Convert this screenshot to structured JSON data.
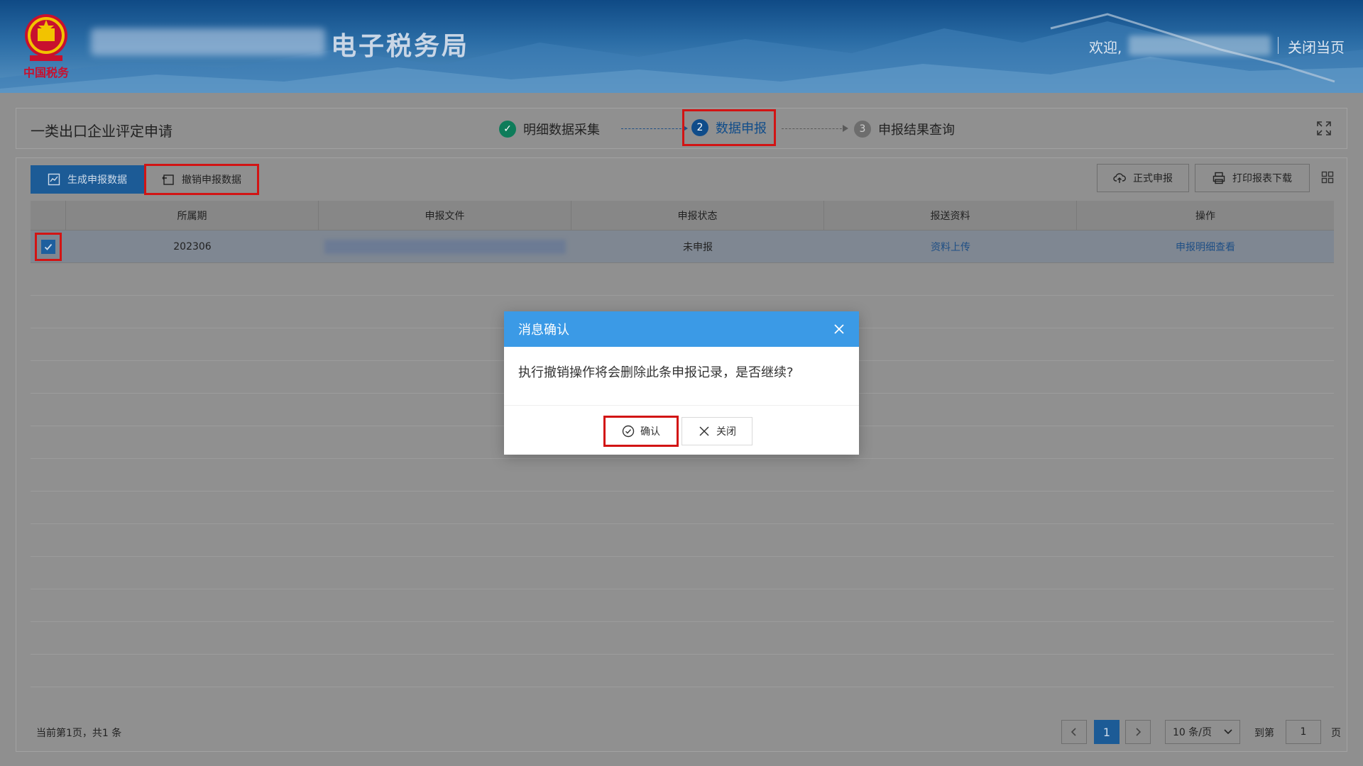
{
  "header": {
    "site_title": "电子税务局",
    "welcome": "欢迎,",
    "close_page": "关闭当页",
    "emblem_text": "中国税务"
  },
  "steps": {
    "heading": "一类出口企业评定申请",
    "items": [
      {
        "num": "✓",
        "label": "明细数据采集",
        "state": "done"
      },
      {
        "num": "2",
        "label": "数据申报",
        "state": "active"
      },
      {
        "num": "3",
        "label": "申报结果查询",
        "state": "pending"
      }
    ]
  },
  "toolbar": {
    "generate_label": "生成申报数据",
    "revoke_label": "撤销申报数据",
    "formal_label": "正式申报",
    "print_label": "打印报表下载"
  },
  "table": {
    "columns": [
      "所属期",
      "申报文件",
      "申报状态",
      "报送资料",
      "操作"
    ],
    "rows": [
      {
        "period": "202306",
        "status": "未申报",
        "upload": "资料上传",
        "action": "申报明细查看"
      }
    ]
  },
  "pager": {
    "summary": "当前第1页，共1 条",
    "current": "1",
    "page_size": "10 条/页",
    "goto": "到第",
    "goto_value": "1",
    "unit": "页"
  },
  "modal": {
    "title": "消息确认",
    "message": "执行撤销操作将会删除此条申报记录，是否继续?",
    "ok_label": "确认",
    "cancel_label": "关闭"
  },
  "colors": {
    "primary": "#1c5b96",
    "modal_header": "#3b9ae6",
    "highlight": "#d21414"
  }
}
